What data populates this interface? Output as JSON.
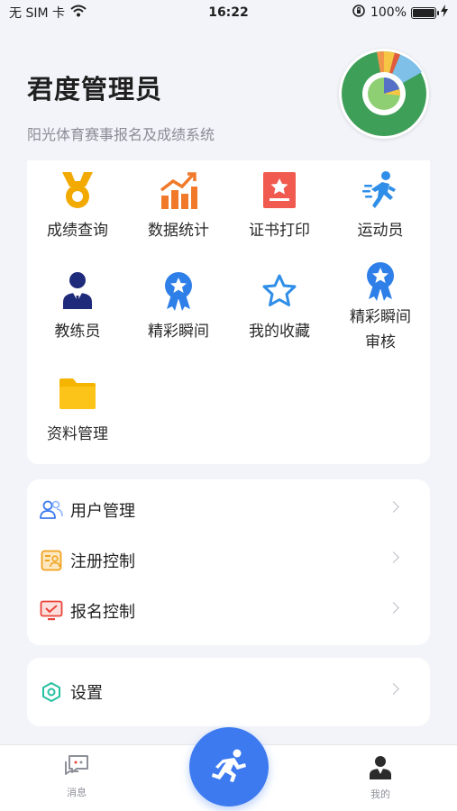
{
  "status_bar": {
    "carrier": "无 SIM 卡",
    "time": "16:22",
    "battery": "100%",
    "battery_level": 1.0
  },
  "header": {
    "title": "君度管理员",
    "subtitle": "阳光体育赛事报名及成绩系统"
  },
  "grid": [
    {
      "label": "成绩查询",
      "icon": "medal-icon"
    },
    {
      "label": "数据统计",
      "icon": "bar-chart-icon"
    },
    {
      "label": "证书打印",
      "icon": "certificate-icon"
    },
    {
      "label": "运动员",
      "icon": "runner-icon"
    },
    {
      "label": "教练员",
      "icon": "coach-icon"
    },
    {
      "label": "精彩瞬间",
      "icon": "star-badge-icon"
    },
    {
      "label": "我的收藏",
      "icon": "star-outline-icon"
    },
    {
      "label": "精彩瞬间审核",
      "line1": "精彩瞬间",
      "line2": "审核",
      "icon": "star-badge-icon"
    },
    {
      "label": "资料管理",
      "icon": "folder-icon"
    }
  ],
  "menu": [
    {
      "label": "用户管理",
      "icon": "users-icon"
    },
    {
      "label": "注册控制",
      "icon": "registration-card-icon"
    },
    {
      "label": "报名控制",
      "icon": "monitor-check-icon"
    }
  ],
  "settings": {
    "label": "设置",
    "icon": "settings-hex-icon"
  },
  "tabbar": {
    "messages": "消息",
    "mine": "我的",
    "center_icon": "runner-icon"
  },
  "colors": {
    "primary": "#3d7af0",
    "orange": "#f2a900",
    "red": "#f05a4f",
    "background": "#f3f4f9",
    "avatar_green": "#3e9f59"
  }
}
